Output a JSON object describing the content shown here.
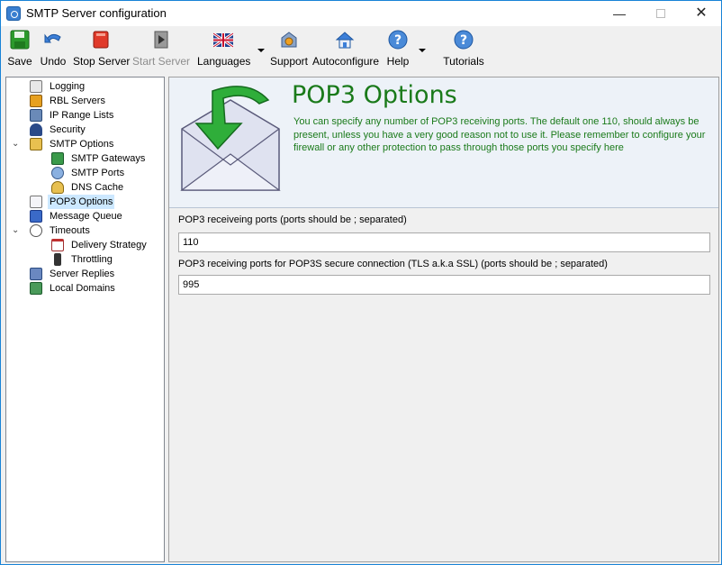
{
  "window": {
    "title": "SMTP Server configuration"
  },
  "titlebar": {
    "minimize": "—",
    "maximize": "",
    "close": "✕"
  },
  "toolbar": {
    "items": [
      {
        "label": "Save",
        "icon": "save-icon",
        "enabled": true
      },
      {
        "label": "Undo",
        "icon": "undo-icon",
        "enabled": true
      },
      {
        "label": "Stop Server",
        "icon": "stop-icon",
        "enabled": true
      },
      {
        "label": "Start Server",
        "icon": "start-icon",
        "enabled": false
      },
      {
        "label": "Languages",
        "icon": "uk-flag-icon",
        "enabled": true
      },
      {
        "label": "Support",
        "icon": "support-icon",
        "enabled": true
      },
      {
        "label": "Autoconfigure",
        "icon": "home-icon",
        "enabled": true
      },
      {
        "label": "Help",
        "icon": "help-icon",
        "enabled": true
      },
      {
        "label": "Tutorials",
        "icon": "help-icon",
        "enabled": true
      }
    ]
  },
  "tree": {
    "items": [
      {
        "label": "Logging",
        "icon": "log-icon"
      },
      {
        "label": "RBL Servers",
        "icon": "rbl-icon"
      },
      {
        "label": "IP Range Lists",
        "icon": "ip-icon"
      },
      {
        "label": "Security",
        "icon": "security-icon"
      },
      {
        "label": "SMTP Options",
        "icon": "smtp-icon",
        "expanded": true
      },
      {
        "label": "SMTP Gateways",
        "icon": "gateway-icon"
      },
      {
        "label": "SMTP Ports",
        "icon": "ports-icon"
      },
      {
        "label": "DNS Cache",
        "icon": "dns-icon"
      },
      {
        "label": "POP3 Options",
        "icon": "pop3-icon",
        "selected": true
      },
      {
        "label": "Message Queue",
        "icon": "queue-icon"
      },
      {
        "label": "Timeouts",
        "icon": "clock-icon",
        "expanded": true
      },
      {
        "label": "Delivery Strategy",
        "icon": "calendar-icon"
      },
      {
        "label": "Throttling",
        "icon": "traffic-light-icon"
      },
      {
        "label": "Server Replies",
        "icon": "server-icon"
      },
      {
        "label": "Local Domains",
        "icon": "domains-icon"
      }
    ]
  },
  "page": {
    "title": "POP3 Options",
    "description": "You can specify any number of POP3 receiving ports. The default one 110, should always be present, unless you have a very good reason not to use it. Please remember to configure your firewall or any other protection to pass through those ports you specify here",
    "pop3_label": "POP3 receiveing ports (ports should be ; separated)",
    "pop3_value": "110",
    "pop3s_label": "POP3 receiving ports for POP3S secure connection (TLS a.k.a SSL)  (ports should be ; separated)",
    "pop3s_value": "995"
  },
  "colors": {
    "accent": "#1a7a1a",
    "selection": "#cce8ff",
    "header_bg": "#edf2f8"
  }
}
